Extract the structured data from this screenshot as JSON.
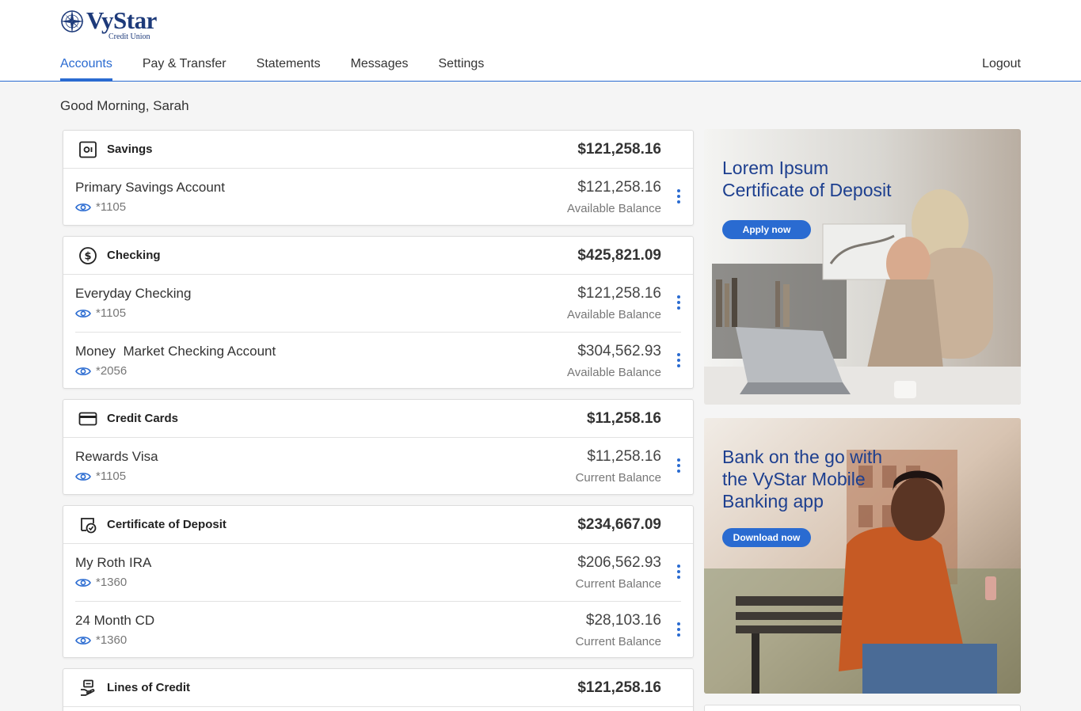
{
  "brand": {
    "name": "VyStar",
    "sub": "Credit Union",
    "color": "#1d3a7a",
    "accent": "#2a6bd1"
  },
  "nav": {
    "items": [
      {
        "label": "Accounts",
        "active": true
      },
      {
        "label": "Pay & Transfer"
      },
      {
        "label": "Statements"
      },
      {
        "label": "Messages"
      },
      {
        "label": "Settings"
      }
    ],
    "logout": "Logout"
  },
  "greeting": "Good Morning, Sarah",
  "categories": [
    {
      "title": "Savings",
      "icon": "safe-icon",
      "total": "$121,258.16",
      "accounts": [
        {
          "name": "Primary Savings Account",
          "number": "*1105",
          "balance": "$121,258.16",
          "balance_label": "Available Balance"
        }
      ]
    },
    {
      "title": "Checking",
      "icon": "dollar-circle-icon",
      "total": "$425,821.09",
      "accounts": [
        {
          "name": "Everyday Checking",
          "number": "*1105",
          "balance": "$121,258.16",
          "balance_label": "Available Balance"
        },
        {
          "name": "Money  Market Checking Account",
          "number": "*2056",
          "balance": "$304,562.93",
          "balance_label": "Available Balance"
        }
      ]
    },
    {
      "title": "Credit Cards",
      "icon": "credit-card-icon",
      "total": "$11,258.16",
      "accounts": [
        {
          "name": "Rewards Visa",
          "number": "*1105",
          "balance": "$11,258.16",
          "balance_label": "Current Balance"
        }
      ]
    },
    {
      "title": "Certificate of Deposit",
      "icon": "certificate-icon",
      "total": "$234,667.09",
      "accounts": [
        {
          "name": "My Roth IRA",
          "number": "*1360",
          "balance": "$206,562.93",
          "balance_label": "Current Balance"
        },
        {
          "name": "24 Month CD",
          "number": "*1360",
          "balance": "$28,103.16",
          "balance_label": "Current Balance"
        }
      ]
    },
    {
      "title": "Lines of Credit",
      "icon": "hand-money-icon",
      "total": "$121,258.16",
      "accounts": []
    }
  ],
  "promos": [
    {
      "title_line1": "Lorem Ipsum",
      "title_line2": "Certificate of Deposit",
      "title_line3": "",
      "button": "Apply now"
    },
    {
      "title_line1": "Bank on the go with",
      "title_line2": "the VyStar Mobile",
      "title_line3": "Banking app",
      "button": "Download now"
    }
  ]
}
